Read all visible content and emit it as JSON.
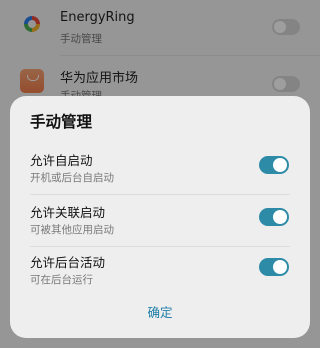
{
  "background_list": {
    "items": [
      {
        "icon": "colorful-ring-icon",
        "title": "EnergyRing",
        "subtitle": "手动管理",
        "enabled": false
      },
      {
        "icon": "huawei-appgallery-icon",
        "title": "华为应用市场",
        "subtitle": "手动管理",
        "enabled": false
      }
    ]
  },
  "dialog": {
    "title": "手动管理",
    "options": [
      {
        "label": "允许自启动",
        "description": "开机或后台自启动",
        "enabled": true
      },
      {
        "label": "允许关联启动",
        "description": "可被其他应用启动",
        "enabled": true
      },
      {
        "label": "允许后台活动",
        "description": "可在后台运行",
        "enabled": true
      }
    ],
    "confirm_label": "确定"
  },
  "colors": {
    "toggle_on": "#2d8ba8",
    "toggle_off": "#d6d6d6",
    "confirm_text": "#1f7fa8",
    "scrim": "rgba(0,0,0,0.38)"
  }
}
